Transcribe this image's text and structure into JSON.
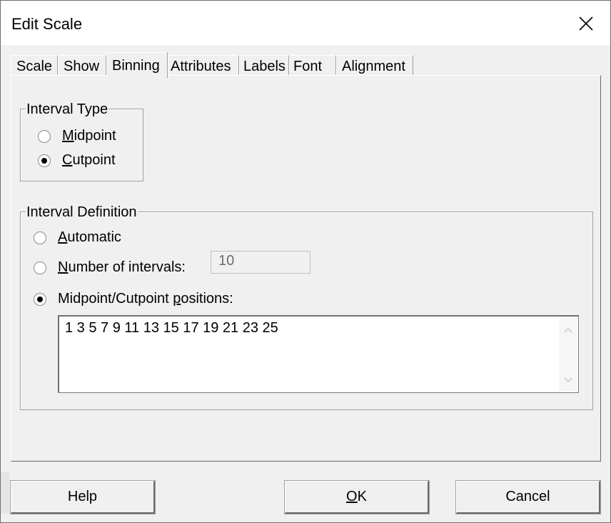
{
  "window": {
    "title": "Edit Scale"
  },
  "tabs": [
    {
      "label": "Scale",
      "active": false
    },
    {
      "label": "Show",
      "active": false
    },
    {
      "label": "Binning",
      "active": true
    },
    {
      "label": "Attributes",
      "active": false
    },
    {
      "label": "Labels",
      "active": false
    },
    {
      "label": "Font",
      "active": false
    },
    {
      "label": "Alignment",
      "active": false
    }
  ],
  "interval_type": {
    "legend": "Interval Type",
    "options": [
      {
        "pre": "",
        "accel": "M",
        "post": "idpoint",
        "checked": false
      },
      {
        "pre": "",
        "accel": "C",
        "post": "utpoint",
        "checked": true
      }
    ]
  },
  "interval_definition": {
    "legend": "Interval Definition",
    "automatic": {
      "pre": "",
      "accel": "A",
      "post": "utomatic",
      "checked": false
    },
    "number": {
      "pre": "",
      "accel": "N",
      "post": "umber of intervals:",
      "checked": false,
      "value": "10"
    },
    "positions": {
      "pre": "Midpoint/Cutpoint ",
      "accel": "p",
      "post": "ositions:",
      "checked": true,
      "value": "1 3 5 7 9 11 13 15 17 19 21 23 25"
    }
  },
  "buttons": {
    "help": "Help",
    "ok": {
      "pre": "",
      "accel": "O",
      "post": "K"
    },
    "cancel": "Cancel"
  },
  "icons": {
    "close": "close-icon",
    "scroll_up": "chevron-up-icon",
    "scroll_down": "chevron-down-icon"
  }
}
